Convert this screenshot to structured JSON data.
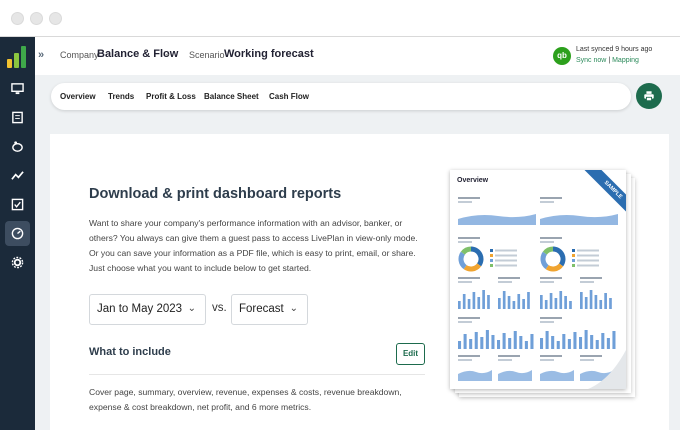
{
  "window": {
    "controls": [
      "close-dot",
      "minimize-dot",
      "maximize-dot"
    ]
  },
  "sidebar": {
    "items": [
      {
        "icon": "monitor-icon",
        "active": false
      },
      {
        "icon": "book-icon",
        "active": false
      },
      {
        "icon": "piggy-bank-icon",
        "active": false
      },
      {
        "icon": "trend-line-icon",
        "active": false
      },
      {
        "icon": "checklist-icon",
        "active": false
      },
      {
        "icon": "dashboard-gauge-icon",
        "active": true
      },
      {
        "icon": "gear-icon",
        "active": false
      }
    ]
  },
  "header": {
    "company_label": "Company",
    "company_value": "Balance & Flow",
    "scenario_label": "Scenario",
    "scenario_value": "Working forecast",
    "qb_badge": "qb",
    "sync_status": "Last synced 9 hours ago",
    "sync_now": "Sync now",
    "separator": "|",
    "mapping": "Mapping"
  },
  "tabs": [
    "Overview",
    "Trends",
    "Profit & Loss",
    "Balance Sheet",
    "Cash Flow"
  ],
  "report": {
    "title": "Download & print dashboard reports",
    "description": "Want to share your company's performance information with an advisor, banker, or others? You always can give them a guest pass to access LivePlan in view-only mode. Or you can save your information as a PDF file, which is easy to print, email, or share. Just choose what you want to include below to get started.",
    "date_range": "Jan to May 2023",
    "vs": "vs.",
    "compare": "Forecast",
    "include_heading": "What to include",
    "edit_label": "Edit",
    "summary": "Cover page, summary, overview, revenue, expenses & costs, revenue breakdown, expense & cost breakdown, net profit, and 6 more metrics."
  },
  "preview": {
    "title": "Overview",
    "ribbon": "SAMPLE"
  },
  "colors": {
    "sidebar_bg": "#1b2a3a",
    "accent_green": "#1d6b4d",
    "content_bg": "#eef1f3",
    "chart_blue": "#6f9fd8",
    "ribbon_blue": "#2b6db0"
  }
}
